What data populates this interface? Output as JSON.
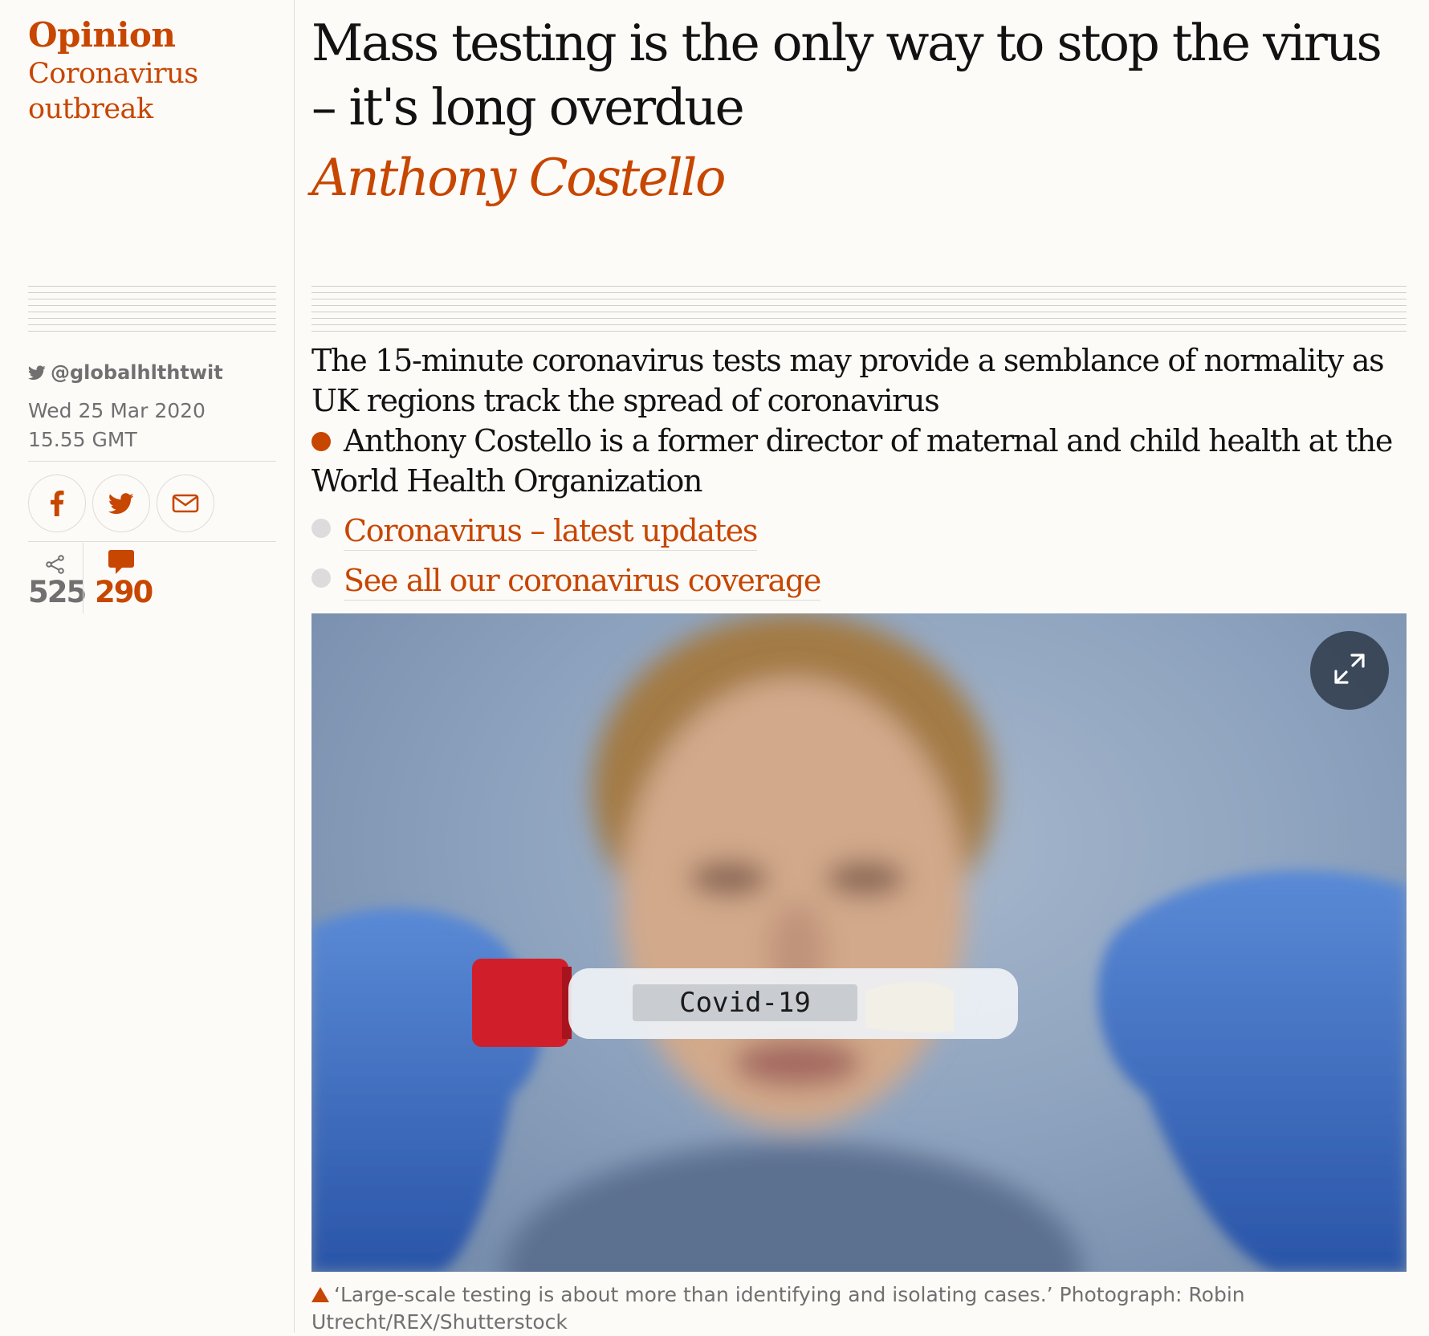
{
  "kicker": {
    "section": "Opinion",
    "series_line1": "Coronavirus",
    "series_line2": "outbreak"
  },
  "headline": "Mass testing is the only way to stop the virus – it's long overdue",
  "byline": "Anthony Costello",
  "meta": {
    "twitter_handle": "@globalhlthtwit",
    "date": "Wed 25 Mar 2020",
    "time": "15.55 GMT"
  },
  "share": {
    "facebook_icon": "facebook-icon",
    "twitter_icon": "twitter-icon",
    "email_icon": "email-icon"
  },
  "counts": {
    "shares": "525",
    "comments": "290"
  },
  "standfirst": {
    "intro": "The 15-minute coronavirus tests may provide a semblance of normality as UK regions track the spread of coronavirus",
    "author_bio": "Anthony Costello is a former director of maternal and child health at the World Health Organization",
    "related": [
      {
        "label": "Coronavirus – latest updates"
      },
      {
        "label": "See all our coronavirus coverage"
      }
    ]
  },
  "photo": {
    "tube_label": "Covid-19"
  },
  "caption": {
    "text": "‘Large-scale testing is about more than identifying and isolating cases.’ Photograph: Robin Utrecht/REX/Shutterstock"
  },
  "colors": {
    "accent": "#c74600",
    "background": "#fdfbf8",
    "text": "#121212",
    "muted": "#707070",
    "rule": "#dcdcdc"
  }
}
